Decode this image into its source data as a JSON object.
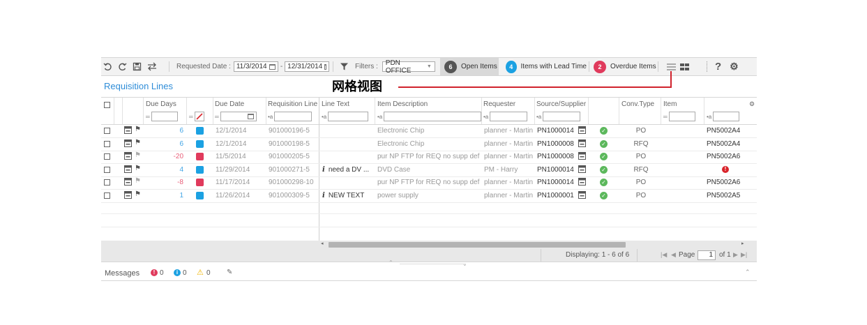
{
  "toolbar": {
    "requested_date_label": "Requested Date :",
    "date_from": "11/3/2014",
    "date_to": "12/31/2014",
    "date_sep": "-",
    "filters_label": "Filters :",
    "filter_value": "PDN OFFICE",
    "tabs": [
      {
        "count": "6",
        "label": "Open Items",
        "color": "#555555"
      },
      {
        "count": "4",
        "label": "Items with Lead Time",
        "color": "#1ba1e2"
      },
      {
        "count": "2",
        "label": "Overdue Items",
        "color": "#e03a5c"
      }
    ],
    "help_label": "?"
  },
  "title": "Requisition Lines",
  "annotation": "网格视图",
  "columns": {
    "due_days": "Due Days",
    "due_date": "Due Date",
    "req_line": "Requisition Line",
    "line_text": "Line Text",
    "item_desc": "Item Description",
    "requester": "Requester",
    "source": "Source/Supplier",
    "conv_type": "Conv.Type",
    "item": "Item"
  },
  "filter_prefix": "•a",
  "rows": [
    {
      "days": "6",
      "days_color": "#42a5e6",
      "status": "#1ba1e2",
      "date": "12/1/2014",
      "line": "901000196-5",
      "text": "",
      "desc": "Electronic Chip",
      "req": "planner - Martin",
      "src": "PN1000014",
      "conv": "PO",
      "item": "PN5002A4"
    },
    {
      "days": "6",
      "days_color": "#42a5e6",
      "status": "#1ba1e2",
      "date": "12/1/2014",
      "line": "901000198-5",
      "text": "",
      "desc": "Electronic Chip",
      "req": "planner - Martin",
      "src": "PN1000008",
      "conv": "RFQ",
      "item": "PN5002A4"
    },
    {
      "days": "-20",
      "days_color": "#e8607a",
      "status": "#e03a5c",
      "date": "11/5/2014",
      "line": "901000205-5",
      "text": "",
      "desc": "pur NP FTP for REQ no supp def",
      "req": "planner - Martin",
      "src": "PN1000008",
      "conv": "PO",
      "item": "PN5002A6"
    },
    {
      "days": "4",
      "days_color": "#42a5e6",
      "status": "#1ba1e2",
      "date": "11/29/2014",
      "line": "901000271-5",
      "text": "need a DV ...",
      "desc": "DVD Case",
      "req": "PM - Harry",
      "src": "PN1000014",
      "conv": "RFQ",
      "item": ""
    },
    {
      "days": "-8",
      "days_color": "#e8607a",
      "status": "#e03a5c",
      "date": "11/17/2014",
      "line": "901000298-10",
      "text": "",
      "desc": "pur NP FTP for REQ no supp def",
      "req": "planner - Martin",
      "src": "PN1000014",
      "conv": "PO",
      "item": "PN5002A6"
    },
    {
      "days": "1",
      "days_color": "#42a5e6",
      "status": "#1ba1e2",
      "date": "11/26/2014",
      "line": "901000309-5",
      "text": "NEW TEXT",
      "desc": "power supply",
      "req": "planner - Martin",
      "src": "PN1000001",
      "conv": "PO",
      "item": "PN5002A5"
    }
  ],
  "pager": {
    "displaying": "Displaying: 1 - 6 of 6",
    "page_label": "Page",
    "page_value": "1",
    "of_label": "of 1"
  },
  "messages": {
    "label": "Messages",
    "errors": "0",
    "infos": "0",
    "warnings": "0"
  }
}
